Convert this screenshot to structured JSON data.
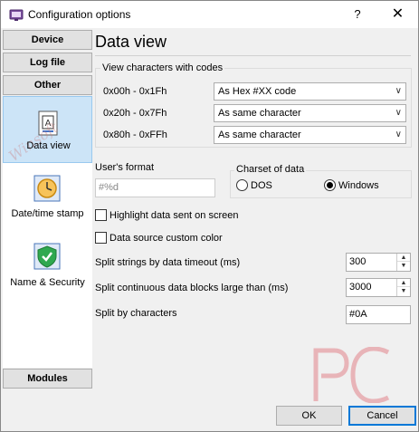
{
  "window": {
    "title": "Configuration options",
    "help_label": "?",
    "close_label": "✕"
  },
  "nav": {
    "buttons": [
      "Device",
      "Log file",
      "Other"
    ],
    "items": [
      {
        "label": "Data view",
        "icon": "data-view-icon",
        "selected": true
      },
      {
        "label": "Date/time stamp",
        "icon": "clock-icon",
        "selected": false
      },
      {
        "label": "Name & Security",
        "icon": "shield-icon",
        "selected": false
      }
    ],
    "modules_label": "Modules",
    "watermark": "Winsoft"
  },
  "content": {
    "title": "Data view",
    "codes_group": {
      "label": "View characters with codes",
      "rows": [
        {
          "range": "0x00h - 0x1Fh",
          "value": "As Hex #XX code"
        },
        {
          "range": "0x20h - 0x7Fh",
          "value": "As same character"
        },
        {
          "range": "0x80h - 0xFFh",
          "value": "As same character"
        }
      ]
    },
    "user_format": {
      "label": "User's format",
      "value": "#%d"
    },
    "charset": {
      "label": "Charset of data",
      "options": [
        {
          "label": "DOS",
          "selected": false
        },
        {
          "label": "Windows",
          "selected": true
        }
      ]
    },
    "checkboxes": [
      {
        "label": "Highlight data sent on screen",
        "checked": false
      },
      {
        "label": "Data source custom color",
        "checked": false
      }
    ],
    "split_timeout": {
      "label": "Split strings by data timeout (ms)",
      "value": "300"
    },
    "split_blocks": {
      "label": "Split continuous data blocks large than (ms)",
      "value": "3000"
    },
    "split_chars": {
      "label": "Split by characters",
      "value": "#0A"
    }
  },
  "footer": {
    "ok_label": "OK",
    "cancel_label": "Cancel"
  },
  "colors": {
    "selected_bg": "#cce4f7",
    "accent": "#0078d7",
    "logo": "#e8b4b8"
  }
}
